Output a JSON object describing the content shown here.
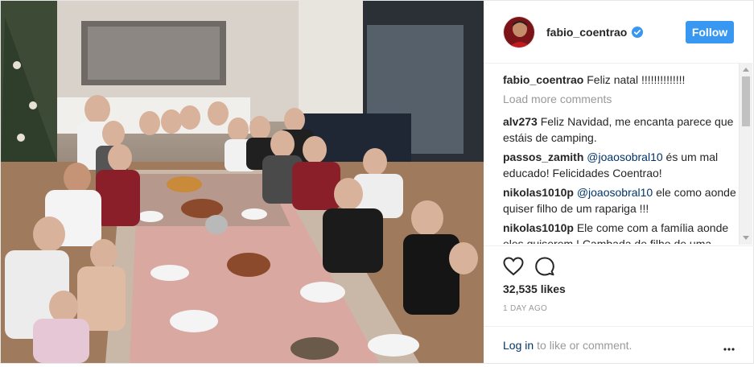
{
  "post": {
    "username": "fabio_coentrao",
    "follow_label": "Follow",
    "caption_user": "fabio_coentrao",
    "caption_text": "Feliz natal !!!!!!!!!!!!!!",
    "load_more": "Load more comments",
    "comments": [
      {
        "user": "alv273",
        "mention": "",
        "text": "Feliz Navidad, me encanta parece que estáis de camping."
      },
      {
        "user": "passos_zamith",
        "mention": "@joaosobral10",
        "text": "és um mal educado! Felicidades Coentrao!"
      },
      {
        "user": "nikolas1010p",
        "mention": "@joaosobral10",
        "text": "ele como aonde quiser filho de um rapariga !!!"
      },
      {
        "user": "nikolas1010p",
        "mention": "",
        "text": "Ele come com a família aonde eles quiserem ! Cambada de filho de uma"
      }
    ],
    "likes": "32,535 likes",
    "timestamp": "1 DAY AGO",
    "login_link": "Log in",
    "login_suffix": "to like or comment.",
    "icons": {
      "like": "heart-icon",
      "comment": "comment-icon",
      "verified": "verified-badge-icon",
      "more": "more-options-icon"
    },
    "colors": {
      "follow_button": "#3897f0",
      "verified_badge": "#3897f0",
      "link": "#003569",
      "muted": "#999999"
    }
  }
}
